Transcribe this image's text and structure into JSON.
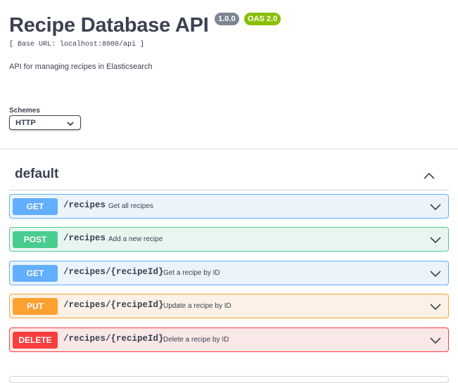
{
  "info": {
    "title": "Recipe Database API",
    "version": "1.0.0",
    "oas": "OAS 2.0",
    "base_url": "[ Base URL: localhost:8000/api ]",
    "description": "API for managing recipes in Elasticsearch"
  },
  "schemes": {
    "label": "Schemes",
    "selected": "HTTP"
  },
  "section": {
    "title": "default"
  },
  "operations": [
    {
      "method": "GET",
      "path": "/recipes",
      "summary": "Get all recipes"
    },
    {
      "method": "POST",
      "path": "/recipes",
      "summary": "Add a new recipe"
    },
    {
      "method": "GET",
      "path": "/recipes/{recipeId}",
      "summary": "Get a recipe by ID"
    },
    {
      "method": "PUT",
      "path": "/recipes/{recipeId}",
      "summary": "Update a recipe by ID"
    },
    {
      "method": "DELETE",
      "path": "/recipes/{recipeId}",
      "summary": "Delete a recipe by ID"
    }
  ],
  "colors": {
    "get": "#61affe",
    "post": "#49cc90",
    "put": "#fca130",
    "delete": "#f93e3e",
    "version_badge": "#7d8492",
    "oas_badge": "#89bf04"
  },
  "icons": {
    "operation_toggle": "chevron-down-icon",
    "section_toggle": "chevron-up-icon",
    "select_toggle": "chevron-down-icon"
  }
}
